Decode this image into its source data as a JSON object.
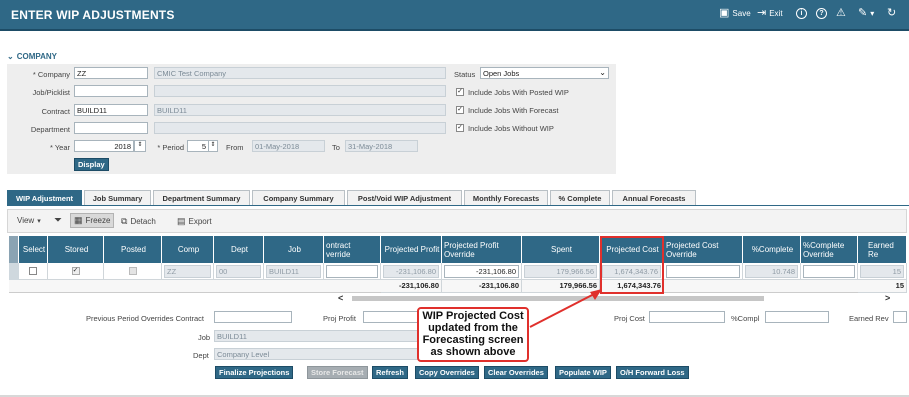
{
  "header": {
    "title": "ENTER WIP ADJUSTMENTS",
    "save_label": "Save",
    "exit_label": "Exit"
  },
  "company_section": {
    "title": "COMPANY",
    "company_label": "* Company",
    "company_value": "ZZ",
    "company_name": "CMIC Test Company",
    "job_label": "Job/Picklist",
    "job_value": "",
    "job_name": "",
    "contract_label": "Contract",
    "contract_value": "BUILD11",
    "contract_name": "BUILD11",
    "department_label": "Department",
    "department_value": "",
    "department_name": "",
    "year_label": "* Year",
    "year_value": "2018",
    "period_label": "* Period",
    "period_value": "5",
    "from_label": "From",
    "from_value": "01-May-2018",
    "to_label": "To",
    "to_value": "31-May-2018",
    "status_label": "Status",
    "status_value": "Open Jobs",
    "checks": [
      {
        "label": "Include Jobs With Posted WIP",
        "checked": true
      },
      {
        "label": "Include Jobs With Forecast",
        "checked": true
      },
      {
        "label": "Include Jobs Without WIP",
        "checked": true
      }
    ],
    "display_button": "Display"
  },
  "tabs": [
    "WIP Adjustment",
    "Job Summary",
    "Department Summary",
    "Company Summary",
    "Post/Void WIP Adjustment",
    "Monthly Forecasts",
    "% Complete",
    "Annual Forecasts"
  ],
  "toolbar": {
    "view": "View",
    "freeze": "Freeze",
    "detach": "Detach",
    "export": "Export"
  },
  "grid": {
    "columns": [
      "Select",
      "Stored",
      "Posted",
      "Comp",
      "Dept",
      "Job",
      "ontract\nverride",
      "Projected Profit",
      "Projected Profit Override",
      "Spent",
      "Projected Cost",
      "Projected Cost Override",
      "%Complete",
      "%Complete Override",
      "Earned Re"
    ],
    "row": {
      "stored": "✓",
      "comp": "ZZ",
      "dept": "00",
      "job": "BUILD11",
      "projected_profit": "-231,106.80",
      "projected_profit_override": "-231,106.80",
      "spent": "179,966.56",
      "projected_cost": "1,674,343.76",
      "pct_complete": "10.748",
      "earned": "15"
    },
    "totals": {
      "projected_profit": "-231,106.80",
      "projected_profit_override": "-231,106.80",
      "spent": "179,966.56",
      "projected_cost": "1,674,343.76",
      "earned": "15"
    }
  },
  "lower": {
    "prev_label": "Previous Period Overrides Contract",
    "proj_profit_label": "Proj Profit",
    "proj_cost_label": "Proj Cost",
    "compl_label": "%Compl",
    "earned_label": "Earned Rev",
    "job_label": "Job",
    "job_value": "BUILD11",
    "dept_label": "Dept",
    "dept_value": "Company Level"
  },
  "buttons": [
    "Finalize Projections",
    "Store Forecast",
    "Refresh",
    "Copy Overrides",
    "Clear Overrides",
    "Populate WIP",
    "O/H Forward Loss"
  ],
  "callout": {
    "text": "WIP Projected Cost updated from the Forecasting screen as shown above"
  }
}
